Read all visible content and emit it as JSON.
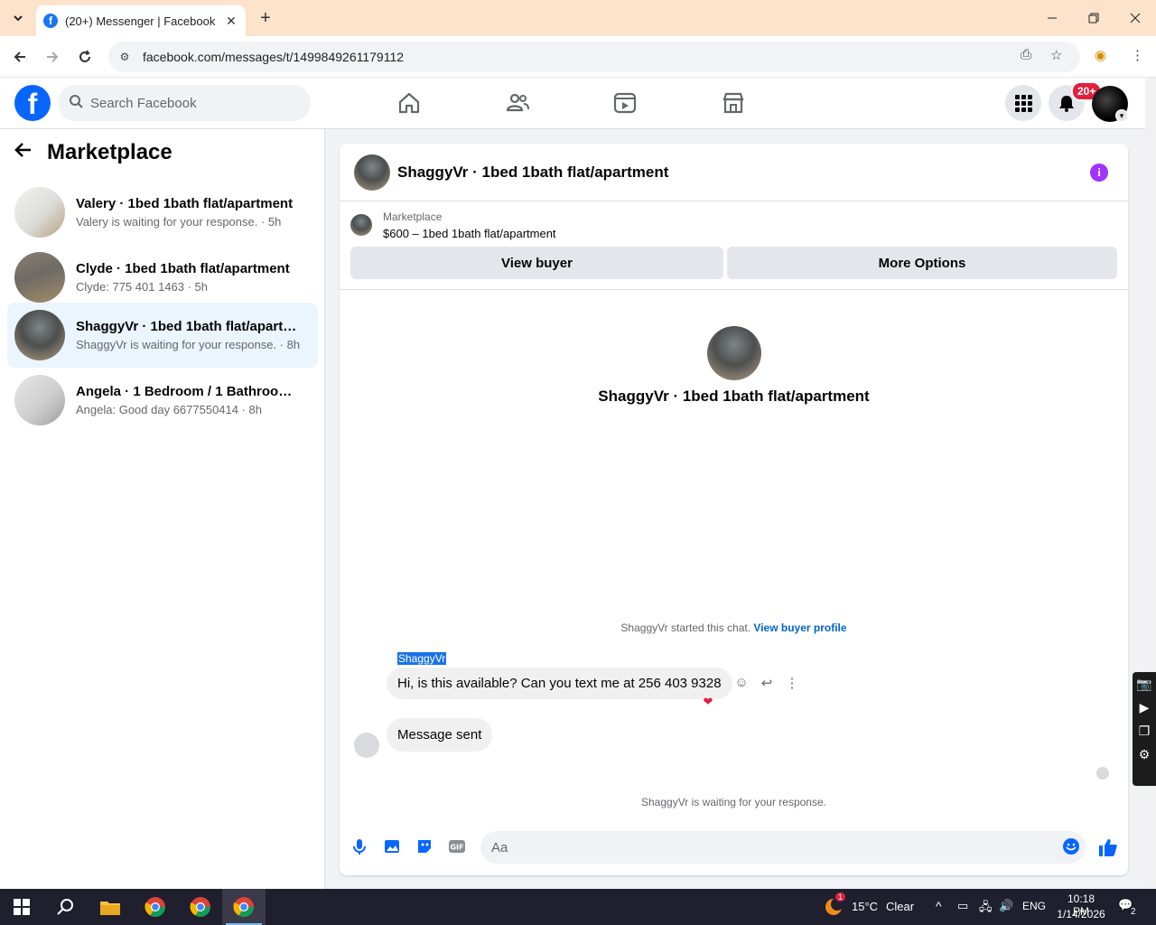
{
  "browser": {
    "tab_title": "(20+) Messenger | Facebook",
    "url": "facebook.com/messages/t/1499849261179112"
  },
  "fb": {
    "logo_letter": "f",
    "search_placeholder": "Search Facebook",
    "notifications_badge": "20+"
  },
  "sidebar": {
    "title": "Marketplace",
    "conversations": [
      {
        "name": "Valery · 1bed 1bath flat/apartment",
        "sub": "Valery is waiting for your response. · 5h",
        "active": false
      },
      {
        "name": "Clyde · 1bed 1bath flat/apartment",
        "sub": "Clyde: 775 401 1463 · 5h",
        "active": false
      },
      {
        "name": "ShaggyVr · 1bed 1bath flat/apartm...",
        "sub": "ShaggyVr is waiting for your response. · 8h",
        "active": true
      },
      {
        "name": "Angela · 1 Bedroom / 1 Bathroom ...",
        "sub": "Angela: Good day 6677550414 · 8h",
        "active": false
      }
    ]
  },
  "chat": {
    "header_title": "ShaggyVr · 1bed 1bath flat/apartment",
    "info_icon": "i",
    "listing_label": "Marketplace",
    "listing_value": "$600 – 1bed 1bath flat/apartment",
    "view_buyer_label": "View buyer",
    "more_options_label": "More Options",
    "profile_name": "ShaggyVr · 1bed 1bath flat/apartment",
    "started_text": "ShaggyVr started this chat.",
    "view_profile_link": "View buyer profile",
    "sender_name": "ShaggyVr",
    "message_text": "Hi, is this available? Can you text me at 256 403 9328",
    "reply_text": "Message sent",
    "waiting_text": "ShaggyVr is waiting for your response.",
    "composer_placeholder": "Aa"
  },
  "taskbar": {
    "weather_temp": "15°C",
    "weather_cond": "Clear",
    "weather_alert": "1",
    "lang": "ENG",
    "time": "10:18 PM",
    "date": "1/14/2026",
    "notif_count": "2"
  },
  "colors": {
    "fb_blue": "#0866ff",
    "active_conv_bg": "#ebf5ff",
    "info_purple": "#a033ff",
    "badge_red": "#e41e3f"
  }
}
